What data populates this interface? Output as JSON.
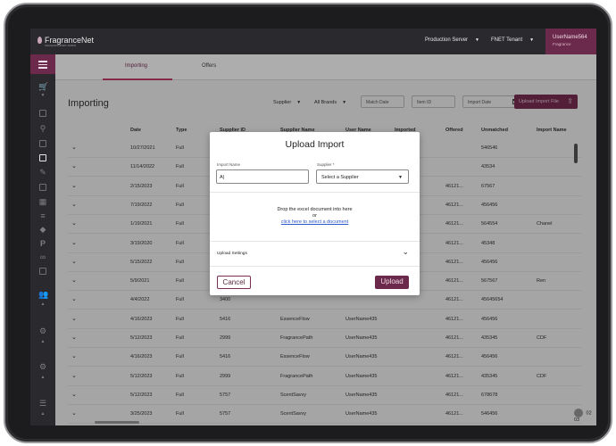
{
  "app": {
    "logo_text": "FragranceNet",
    "logo_subtext": "FRAGRANCENET ADMIN",
    "server": "Production Server",
    "tenant": "FNET Tenant",
    "user_name": "UserName564",
    "user_role": "Fragrance"
  },
  "tabs": [
    {
      "label": "Importing",
      "active": true
    },
    {
      "label": "Offers",
      "active": false
    }
  ],
  "page": {
    "title": "Importing",
    "filters": {
      "supplier": "Supplier",
      "brands": "All Brands",
      "match_date_placeholder": "Match Date",
      "item_id_placeholder": "Item ID",
      "import_date_placeholder": "Import Date"
    },
    "upload_button": "Upload Import File"
  },
  "table": {
    "columns": [
      "Date",
      "Type",
      "Supplier ID",
      "Supplier Name",
      "User Name",
      "Imported",
      "Offered",
      "Unmatched",
      "Import Name"
    ],
    "rows": [
      {
        "date": "10/27/2021",
        "type": "Full",
        "supplier_id": "4173",
        "supplier_name": "",
        "user_name": "",
        "offered": "",
        "unmatched": "546546",
        "import_name": ""
      },
      {
        "date": "11/14/2022",
        "type": "Full",
        "supplier_id": "592",
        "supplier_name": "",
        "user_name": "",
        "offered": "",
        "unmatched": "43534",
        "import_name": ""
      },
      {
        "date": "2/15/2023",
        "type": "Full",
        "supplier_id": "1117",
        "supplier_name": "",
        "user_name": "",
        "offered": "46121...",
        "unmatched": "67567",
        "import_name": ""
      },
      {
        "date": "7/19/2022",
        "type": "Full",
        "supplier_id": "6700",
        "supplier_name": "",
        "user_name": "",
        "offered": "46121...",
        "unmatched": "456456",
        "import_name": ""
      },
      {
        "date": "1/19/2021",
        "type": "Full",
        "supplier_id": "1431",
        "supplier_name": "",
        "user_name": "",
        "offered": "46121...",
        "unmatched": "564554",
        "import_name": "Chanel"
      },
      {
        "date": "3/19/2020",
        "type": "Full",
        "supplier_id": "7698",
        "supplier_name": "",
        "user_name": "",
        "offered": "46121...",
        "unmatched": "45348",
        "import_name": ""
      },
      {
        "date": "5/15/2022",
        "type": "Full",
        "supplier_id": "5491",
        "supplier_name": "",
        "user_name": "",
        "offered": "46121...",
        "unmatched": "456456",
        "import_name": ""
      },
      {
        "date": "5/9/2021",
        "type": "Full",
        "supplier_id": "7457",
        "supplier_name": "",
        "user_name": "",
        "offered": "46121...",
        "unmatched": "567567",
        "import_name": "Ren"
      },
      {
        "date": "4/4/2022",
        "type": "Full",
        "supplier_id": "3400",
        "supplier_name": "",
        "user_name": "",
        "offered": "46121...",
        "unmatched": "45645654",
        "import_name": ""
      },
      {
        "date": "4/16/2023",
        "type": "Full",
        "supplier_id": "5416",
        "supplier_name": "EssenceFlow",
        "user_name": "UserName435",
        "offered": "46121...",
        "unmatched": "456456",
        "import_name": ""
      },
      {
        "date": "5/12/2023",
        "type": "Full",
        "supplier_id": "2999",
        "supplier_name": "FragrancePath",
        "user_name": "UserName435",
        "offered": "46121...",
        "unmatched": "435345",
        "import_name": "CDF"
      },
      {
        "date": "4/16/2023",
        "type": "Full",
        "supplier_id": "5416",
        "supplier_name": "EssenceFlow",
        "user_name": "UserName435",
        "offered": "46121...",
        "unmatched": "456456",
        "import_name": ""
      },
      {
        "date": "5/12/2023",
        "type": "Full",
        "supplier_id": "2999",
        "supplier_name": "FragrancePath",
        "user_name": "UserName435",
        "offered": "46121...",
        "unmatched": "435345",
        "import_name": "CDF"
      },
      {
        "date": "5/12/2023",
        "type": "Full",
        "supplier_id": "5757",
        "supplier_name": "ScentSavvy",
        "user_name": "UserName435",
        "offered": "46121...",
        "unmatched": "678678",
        "import_name": ""
      },
      {
        "date": "3/25/2023",
        "type": "Full",
        "supplier_id": "5757",
        "supplier_name": "ScentSavvy",
        "user_name": "UserName435",
        "offered": "46121...",
        "unmatched": "546456",
        "import_name": ""
      }
    ]
  },
  "pager": {
    "current": "02",
    "total": "03"
  },
  "modal": {
    "title": "Upload Import",
    "import_name_label": "Import Name",
    "import_name_value": "A|",
    "supplier_label": "Supplier *",
    "supplier_value": "Select a Supplier",
    "drop_line1": "Drop the excel document into here",
    "drop_line2": "or",
    "drop_link": "click here to select a document",
    "settings_label": "Upload Settings",
    "cancel_label": "Cancel",
    "upload_label": "Upload"
  },
  "colors": {
    "brand": "#6b2a4b",
    "accent": "#c63f6f",
    "link": "#2a58c9"
  }
}
